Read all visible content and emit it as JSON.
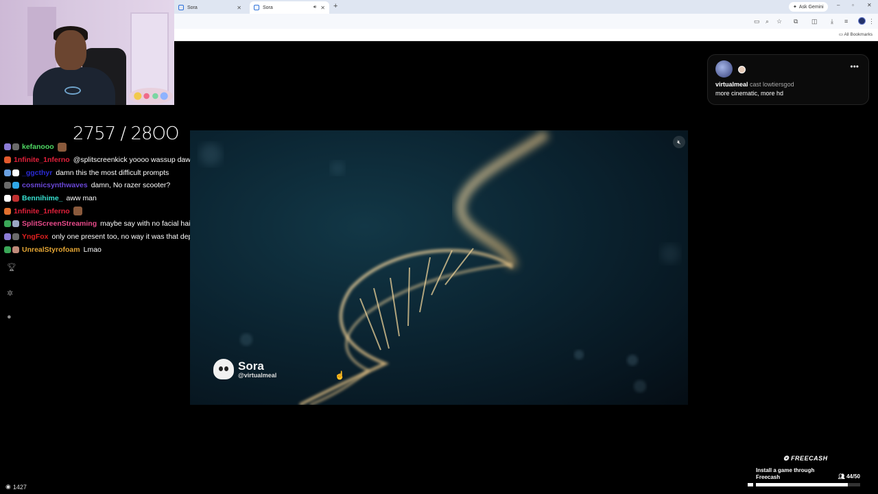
{
  "browser": {
    "tabs": [
      {
        "title": "Sora",
        "active": false
      },
      {
        "title": "Sora",
        "active": true
      }
    ],
    "gemini_label": "Ask Gemini",
    "bookmarks_label": "All Bookmarks"
  },
  "stream": {
    "goal": "2757 / 28OO",
    "viewers": "1427"
  },
  "chat": {
    "messages": [
      {
        "user": "kefanooo",
        "color": "#4fd964",
        "text": "",
        "emote": true
      },
      {
        "user": "1nfinite_1nferno",
        "color": "#e0203a",
        "text": "@splitscreenkick yoooo wassup dawg"
      },
      {
        "user": "_ggcthyr",
        "color": "#2b2bd6",
        "text": "damn this the most difficult prompts"
      },
      {
        "user": "cosmicsynthwaves",
        "color": "#6a47d8",
        "text": "damn, No razer scooter?"
      },
      {
        "user": "Bennihime_",
        "color": "#37e0d0",
        "text": "aww man"
      },
      {
        "user": "1nfinite_1nferno",
        "color": "#e0203a",
        "text": "",
        "emote": true
      },
      {
        "user": "SplitScreenStreaming",
        "color": "#e84a8a",
        "text": "maybe say with no facial hair?"
      },
      {
        "user": "YngFox",
        "color": "#e02020",
        "text": "only one present too, no way it was that depressing"
      },
      {
        "user": "UnrealStyrofoam",
        "color": "#e3a534",
        "text": "Lmao"
      }
    ]
  },
  "video": {
    "watermark_name": "Sora",
    "watermark_handle": "@virtualmeal"
  },
  "prompt_card": {
    "username": "virtualmeal",
    "cast_text": "cast lowtiersgod",
    "prompt": "more cinematic, more hd"
  },
  "freecash": {
    "brand": "FREECASH",
    "text": "Install a game through Freecash",
    "count": "44/50",
    "progress": 0.88
  }
}
